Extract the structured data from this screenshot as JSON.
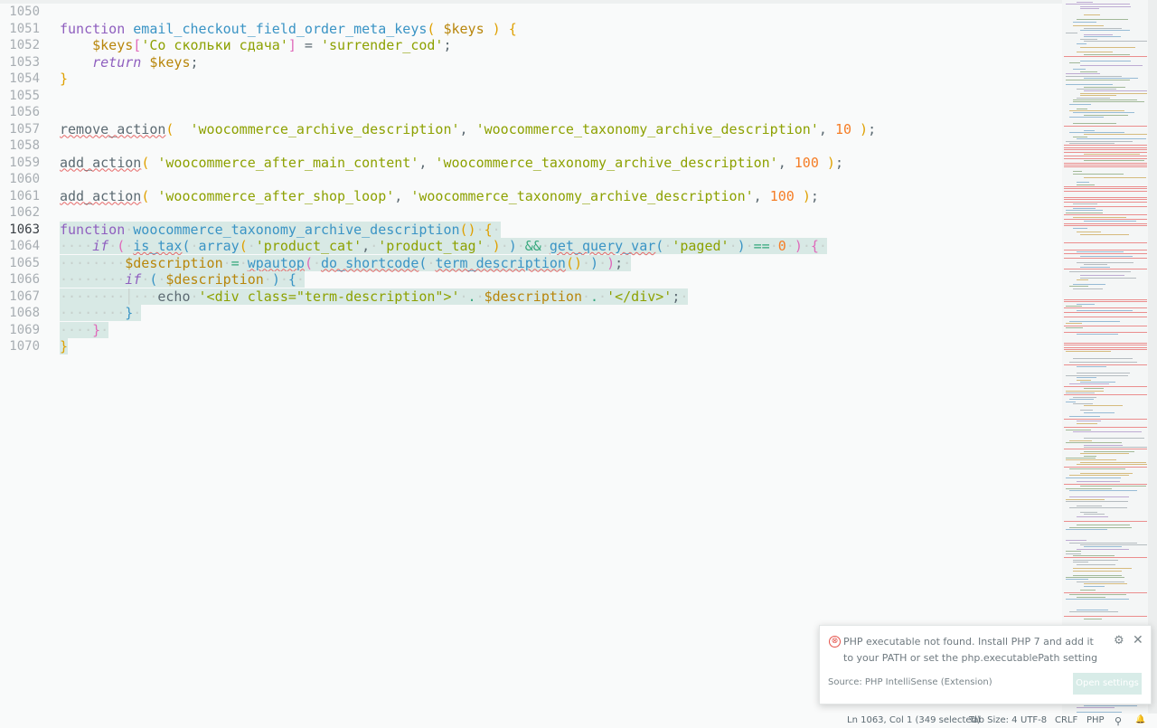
{
  "editor": {
    "lines": [
      {
        "n": "1050",
        "tokens": []
      },
      {
        "n": "1051",
        "tokens": [
          [
            "kw",
            "function"
          ],
          [
            "pl",
            " "
          ],
          [
            "fn",
            "email_checkout_field_order_meta_keys"
          ],
          [
            "br1",
            "("
          ],
          [
            "pl",
            " "
          ],
          [
            "var",
            "$keys"
          ],
          [
            "pl",
            " "
          ],
          [
            "br1",
            ")"
          ],
          [
            "pl",
            " "
          ],
          [
            "br1",
            "{"
          ]
        ]
      },
      {
        "n": "1052",
        "tokens": [
          [
            "pl",
            "    "
          ],
          [
            "var",
            "$keys"
          ],
          [
            "br2",
            "["
          ],
          [
            "str",
            "'Со скольки сдача'"
          ],
          [
            "br2",
            "]"
          ],
          [
            "pl",
            " = "
          ],
          [
            "str",
            "'surrender_cod'"
          ],
          [
            "pl",
            ";"
          ]
        ]
      },
      {
        "n": "1053",
        "tokens": [
          [
            "pl",
            "    "
          ],
          [
            "kwi",
            "return"
          ],
          [
            "pl",
            " "
          ],
          [
            "var",
            "$keys"
          ],
          [
            "pl",
            ";"
          ]
        ]
      },
      {
        "n": "1054",
        "tokens": [
          [
            "br1",
            "}"
          ]
        ]
      },
      {
        "n": "1055",
        "tokens": []
      },
      {
        "n": "1056",
        "tokens": []
      },
      {
        "n": "1057",
        "tokens": [
          [
            "fnu2",
            "remove_action"
          ],
          [
            "br1",
            "("
          ],
          [
            "pl",
            "  "
          ],
          [
            "str",
            "'woocommerce_archive_description'"
          ],
          [
            "pl",
            ", "
          ],
          [
            "str",
            "'woocommerce_taxonomy_archive_description'"
          ],
          [
            "pl",
            ", "
          ],
          [
            "num",
            "10"
          ],
          [
            "pl",
            " "
          ],
          [
            "br1",
            ")"
          ],
          [
            "pl",
            ";"
          ]
        ]
      },
      {
        "n": "1058",
        "tokens": []
      },
      {
        "n": "1059",
        "tokens": [
          [
            "fnu2",
            "add_action"
          ],
          [
            "br1",
            "("
          ],
          [
            "pl",
            " "
          ],
          [
            "str",
            "'woocommerce_after_main_content'"
          ],
          [
            "pl",
            ", "
          ],
          [
            "str",
            "'woocommerce_taxonomy_archive_description'"
          ],
          [
            "pl",
            ", "
          ],
          [
            "num",
            "100"
          ],
          [
            "pl",
            " "
          ],
          [
            "br1",
            ")"
          ],
          [
            "pl",
            ";"
          ]
        ]
      },
      {
        "n": "1060",
        "tokens": []
      },
      {
        "n": "1061",
        "tokens": [
          [
            "fnu2",
            "add_action"
          ],
          [
            "br1",
            "("
          ],
          [
            "pl",
            " "
          ],
          [
            "str",
            "'woocommerce_after_shop_loop'"
          ],
          [
            "pl",
            ", "
          ],
          [
            "str",
            "'woocommerce_taxonomy_archive_description'"
          ],
          [
            "pl",
            ", "
          ],
          [
            "num",
            "100"
          ],
          [
            "pl",
            " "
          ],
          [
            "br1",
            ")"
          ],
          [
            "pl",
            ";"
          ]
        ]
      },
      {
        "n": "1062",
        "tokens": []
      },
      {
        "n": "1063",
        "active": true,
        "cursor": true,
        "sel": true,
        "tokens": [
          [
            "kw",
            "function"
          ],
          [
            "ws",
            "·"
          ],
          [
            "fn",
            "woocommerce_taxonomy_archive_description"
          ],
          [
            "br1",
            "()"
          ],
          [
            "ws",
            "·"
          ],
          [
            "br1",
            "{"
          ],
          [
            "ws",
            "·"
          ]
        ]
      },
      {
        "n": "1064",
        "sel": true,
        "tokens": [
          [
            "ws",
            "····"
          ],
          [
            "kwi",
            "if"
          ],
          [
            "ws",
            "·"
          ],
          [
            "br2",
            "("
          ],
          [
            "ws",
            "·"
          ],
          [
            "fnu",
            "is_tax"
          ],
          [
            "br3",
            "("
          ],
          [
            "ws",
            "·"
          ],
          [
            "fn",
            "array"
          ],
          [
            "br1",
            "("
          ],
          [
            "ws",
            "·"
          ],
          [
            "str",
            "'product_cat'"
          ],
          [
            "pl",
            ","
          ],
          [
            "ws",
            "·"
          ],
          [
            "str",
            "'product_tag'"
          ],
          [
            "ws",
            "·"
          ],
          [
            "br1",
            ")"
          ],
          [
            "ws",
            "·"
          ],
          [
            "br3",
            ")"
          ],
          [
            "ws",
            "·"
          ],
          [
            "op",
            "&&"
          ],
          [
            "ws",
            "·"
          ],
          [
            "fnu",
            "get_query_var"
          ],
          [
            "br3",
            "("
          ],
          [
            "ws",
            "·"
          ],
          [
            "str",
            "'paged'"
          ],
          [
            "ws",
            "·"
          ],
          [
            "br3",
            ")"
          ],
          [
            "ws",
            "·"
          ],
          [
            "op",
            "=="
          ],
          [
            "ws",
            "·"
          ],
          [
            "num",
            "0"
          ],
          [
            "ws",
            "·"
          ],
          [
            "br2",
            ")"
          ],
          [
            "ws",
            "·"
          ],
          [
            "br2",
            "{"
          ],
          [
            "ws",
            "·"
          ]
        ]
      },
      {
        "n": "1065",
        "sel": true,
        "tokens": [
          [
            "ws",
            "········"
          ],
          [
            "var",
            "$description"
          ],
          [
            "ws",
            "·"
          ],
          [
            "op",
            "="
          ],
          [
            "ws",
            "·"
          ],
          [
            "fnu",
            "wpautop"
          ],
          [
            "br2",
            "("
          ],
          [
            "ws",
            "·"
          ],
          [
            "fnu",
            "do_shortcode"
          ],
          [
            "br3",
            "("
          ],
          [
            "ws",
            "·"
          ],
          [
            "fnu",
            "term_description"
          ],
          [
            "br1",
            "()"
          ],
          [
            "ws",
            "·"
          ],
          [
            "br3",
            ")"
          ],
          [
            "ws",
            "·"
          ],
          [
            "br2",
            ")"
          ],
          [
            "pl",
            ";"
          ],
          [
            "ws",
            "·"
          ]
        ]
      },
      {
        "n": "1066",
        "sel": true,
        "tokens": [
          [
            "ws",
            "········"
          ],
          [
            "kwi",
            "if"
          ],
          [
            "ws",
            "·"
          ],
          [
            "br3",
            "("
          ],
          [
            "ws",
            "·"
          ],
          [
            "var",
            "$description"
          ],
          [
            "ws",
            "·"
          ],
          [
            "br3",
            ")"
          ],
          [
            "ws",
            "·"
          ],
          [
            "br3",
            "{"
          ],
          [
            "ws",
            "·"
          ]
        ]
      },
      {
        "n": "1067",
        "sel": true,
        "tokens": [
          [
            "ws",
            "········│···"
          ],
          [
            "pl",
            "echo"
          ],
          [
            "ws",
            "·"
          ],
          [
            "str",
            "'<div class=\"term-description\">'"
          ],
          [
            "ws",
            "·"
          ],
          [
            "op",
            "."
          ],
          [
            "ws",
            "·"
          ],
          [
            "var",
            "$description"
          ],
          [
            "ws",
            "·"
          ],
          [
            "op",
            "."
          ],
          [
            "ws",
            "·"
          ],
          [
            "str",
            "'</div>'"
          ],
          [
            "pl",
            ";"
          ],
          [
            "ws",
            "·"
          ]
        ]
      },
      {
        "n": "1068",
        "sel": true,
        "tokens": [
          [
            "ws",
            "········"
          ],
          [
            "br3",
            "}"
          ],
          [
            "ws",
            "·"
          ]
        ]
      },
      {
        "n": "1069",
        "sel": true,
        "tokens": [
          [
            "ws",
            "····"
          ],
          [
            "br2",
            "}"
          ],
          [
            "ws",
            "·"
          ]
        ]
      },
      {
        "n": "1070",
        "sel": true,
        "tokens": [
          [
            "br1",
            "}"
          ]
        ]
      }
    ]
  },
  "notification": {
    "message": "PHP executable not found. Install PHP 7 and add it to your PATH or set the php.executablePath setting",
    "source": "Source: PHP IntelliSense (Extension)",
    "button": "Open settings",
    "error_icon": "⊗",
    "gear_icon": "⚙",
    "close_icon": "✕"
  },
  "statusbar": {
    "position": "Ln 1063, Col 1 (349 selected)",
    "tab_size": "Tab Size: 4",
    "encoding": "UTF-8",
    "eol": "CRLF",
    "language": "PHP",
    "feedback_icon": "⚲",
    "bell_icon": "🔔"
  },
  "colors": {
    "background": "#f9fafa",
    "selection": "#d8e9e5",
    "error": "#e66868"
  }
}
